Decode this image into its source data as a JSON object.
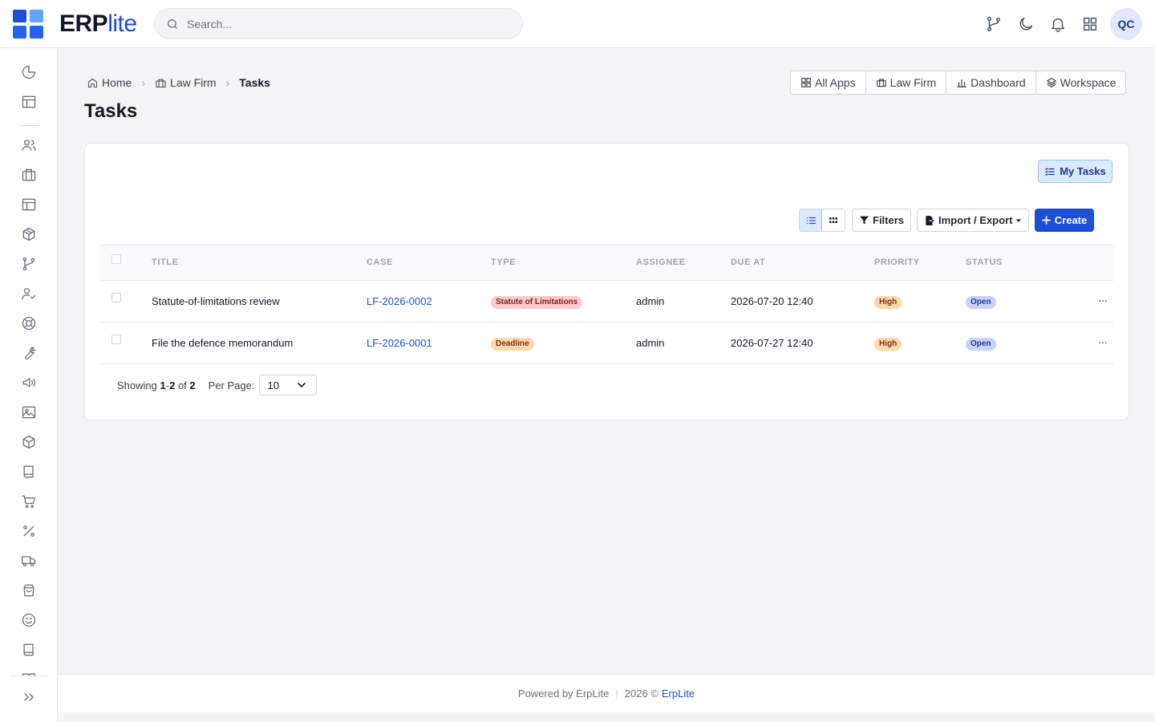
{
  "brand": {
    "name_bold": "ERP",
    "name_light": "lite",
    "colors": [
      "#1d4ed8",
      "#60a5fa",
      "#2563eb",
      "#3b82f6"
    ]
  },
  "search": {
    "placeholder": "Search..."
  },
  "topbar": {
    "icons": [
      "git-branch-icon",
      "moon-icon",
      "bell-icon",
      "grid-icon"
    ],
    "avatar_initials": "QC"
  },
  "sidebar": {
    "icons": [
      "pie-chart-icon",
      "layout-icon",
      "users-icon",
      "briefcase-icon",
      "layout-icon",
      "package-icon",
      "git-branch-icon",
      "user-check-icon",
      "life-buoy-icon",
      "wrench-icon",
      "megaphone-icon",
      "image-icon",
      "box-icon",
      "book-icon",
      "cart-icon",
      "percent-icon",
      "truck-icon",
      "shopping-bag-icon",
      "smile-icon",
      "book-icon"
    ],
    "expand_icon": "chevrons-right-icon"
  },
  "breadcrumb": {
    "items": [
      {
        "label": "Home",
        "icon": "home-icon"
      },
      {
        "label": "Law Firm",
        "icon": "building-icon"
      },
      {
        "label": "Tasks"
      }
    ]
  },
  "page": {
    "title": "Tasks"
  },
  "app_switcher": [
    {
      "label": "All Apps",
      "icon": "grid-icon"
    },
    {
      "label": "Law Firm",
      "icon": "building-icon"
    },
    {
      "label": "Dashboard",
      "icon": "bar-chart-icon"
    },
    {
      "label": "Workspace",
      "icon": "layers-icon"
    }
  ],
  "toolbar": {
    "my_tasks": "My Tasks",
    "filters": "Filters",
    "import_export": "Import / Export",
    "create": "Create"
  },
  "table": {
    "columns": [
      "TITLE",
      "CASE",
      "TYPE",
      "ASSIGNEE",
      "DUE AT",
      "PRIORITY",
      "STATUS"
    ],
    "rows": [
      {
        "title": "Statute-of-limitations review",
        "case": "LF-2026-0002",
        "type": "Statute of Limitations",
        "assignee": "admin",
        "due_at": "2026-07-20 12:40",
        "priority": "High",
        "status": "Open"
      },
      {
        "title": "File the defence memorandum",
        "case": "LF-2026-0001",
        "type": "Deadline",
        "assignee": "admin",
        "due_at": "2026-07-27 12:40",
        "priority": "High",
        "status": "Open"
      }
    ]
  },
  "pagination": {
    "showing_label": "Showing",
    "range_start": "1",
    "range_sep": "-",
    "range_end": "2",
    "of_label": "of",
    "total": "2",
    "per_page_label": "Per Page:",
    "per_page_value": "10"
  },
  "footer": {
    "powered_by": "Powered by ErpLite",
    "copyright": "2026 ©",
    "brand_link": "ErpLite"
  }
}
